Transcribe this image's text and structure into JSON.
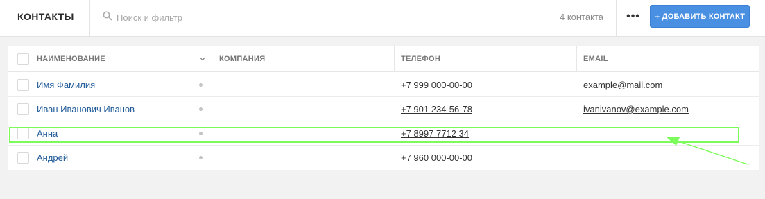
{
  "header": {
    "title": "КОНТАКТЫ",
    "search_placeholder": "Поиск и фильтр",
    "search_value": "",
    "count": "4 контакта",
    "more_label": "•••",
    "add_label": "ДОБАВИТЬ КОНТАКТ",
    "add_icon": "+"
  },
  "table": {
    "columns": {
      "name": "НАИМЕНОВАНИЕ",
      "company": "КОМПАНИЯ",
      "phone": "ТЕЛЕФОН",
      "email": "EMAIL"
    },
    "rows": [
      {
        "name": "Имя Фамилия",
        "company": "",
        "phone": "+7 999 000-00-00",
        "email": "example@mail.com"
      },
      {
        "name": "Иван Иванович Иванов",
        "company": "",
        "phone": "+7 901 234-56-78",
        "email": "ivanivanov@example.com"
      },
      {
        "name": "Анна",
        "company": "",
        "phone": "+7 8997 7712 34",
        "email": ""
      },
      {
        "name": "Андрей",
        "company": "",
        "phone": "+7 960 000-00-00",
        "email": ""
      }
    ]
  },
  "colors": {
    "accent": "#4a90e2",
    "link": "#1f5a99",
    "annotation": "#7cfc5a"
  },
  "icons": {
    "search": "search-icon",
    "sort": "chevron-down-icon",
    "more": "more-icon",
    "add": "plus-icon"
  }
}
